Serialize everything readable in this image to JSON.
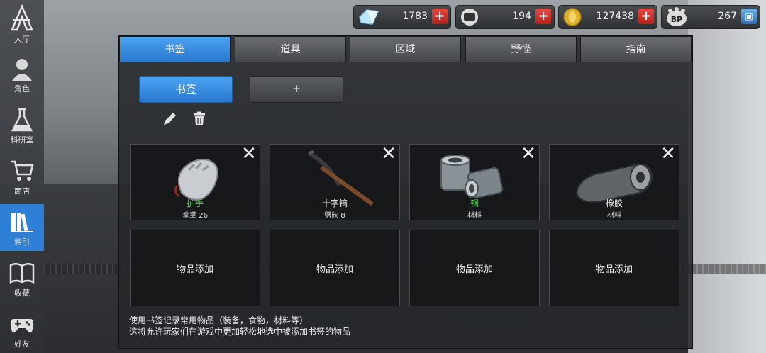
{
  "sidebar": {
    "logo_label": "大厅",
    "items": [
      {
        "label": "角色",
        "icon": "character-icon"
      },
      {
        "label": "科研室",
        "icon": "flask-icon"
      },
      {
        "label": "商店",
        "icon": "cart-icon"
      },
      {
        "label": "索引",
        "icon": "books-icon",
        "active": true
      },
      {
        "label": "收藏",
        "icon": "open-book-icon"
      },
      {
        "label": "好友",
        "icon": "gamepad-icon"
      }
    ]
  },
  "currencies": [
    {
      "icon": "diamond-icon",
      "value": "1783"
    },
    {
      "icon": "ticket-icon",
      "value": "194"
    },
    {
      "icon": "coin-icon",
      "value": "127438"
    },
    {
      "icon": "bp-icon",
      "value": "267"
    }
  ],
  "tabs": [
    "书签",
    "道具",
    "区域",
    "野怪",
    "指南"
  ],
  "bookmark_button": "书签",
  "add_button": "+",
  "items": [
    {
      "name": "护手",
      "sub": "拳掌 26",
      "highlight": true
    },
    {
      "name": "十字镐",
      "sub": "劈砍 8",
      "highlight": false
    },
    {
      "name": "钢",
      "sub": "材料",
      "highlight": true
    },
    {
      "name": "橡胶",
      "sub": "材料",
      "highlight": false
    }
  ],
  "empty_slots": [
    "物品添加",
    "物品添加",
    "物品添加",
    "物品添加"
  ],
  "info": {
    "line1": "使用书签记录常用物品（装备，食物，材料等）",
    "line2": "这将允许玩家们在游戏中更加轻松地选中被添加书签的物品"
  }
}
